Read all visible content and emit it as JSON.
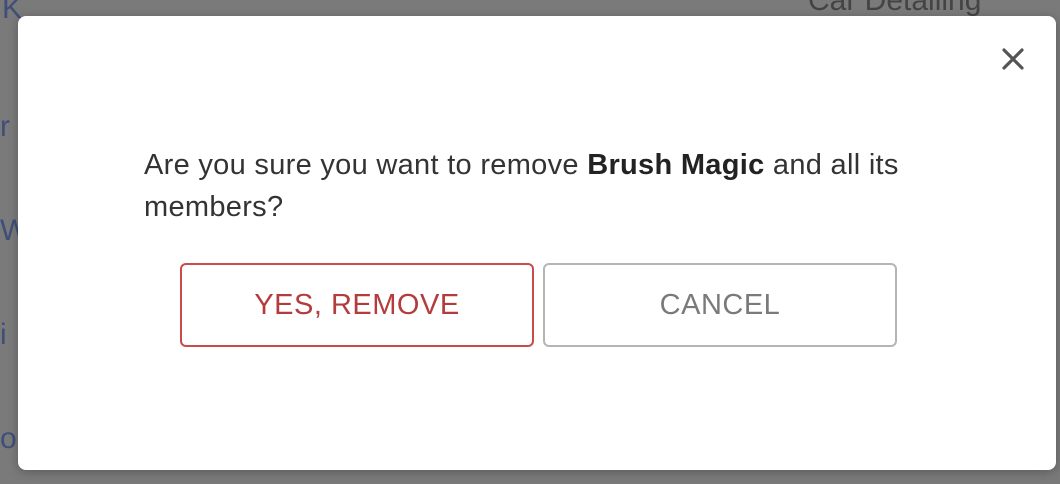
{
  "background": {
    "fragments": [
      "K",
      "r",
      "W",
      "i",
      "o",
      "Car Detailing"
    ]
  },
  "dialog": {
    "message_prefix": "Are you sure you want to remove ",
    "entity_name": "Brush Magic",
    "message_suffix": " and all its members?",
    "close_icon": "close-icon",
    "confirm_label": "YES, REMOVE",
    "cancel_label": "CANCEL"
  },
  "colors": {
    "confirm": "#c94b4b",
    "cancel": "#b5b5b5",
    "overlay": "#7a7a7a"
  }
}
